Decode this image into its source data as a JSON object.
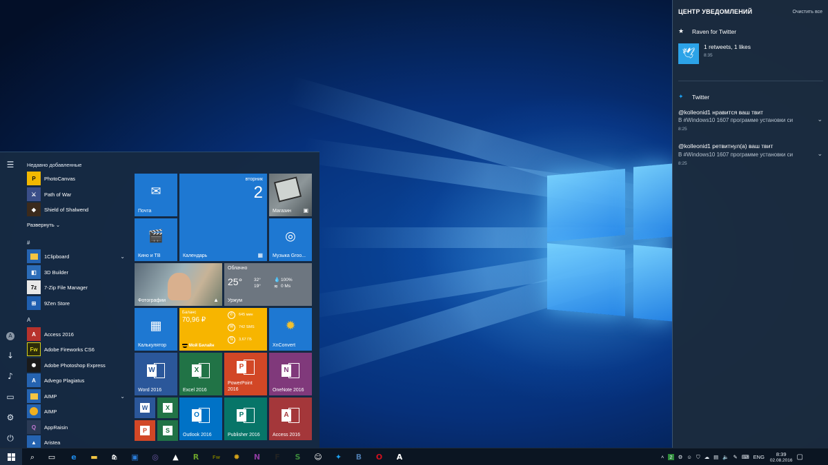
{
  "start_menu": {
    "recently_added_header": "Недавно добавленные",
    "recent": [
      {
        "label": "PhotoCanvas",
        "icon": "photocanvas-icon",
        "color": "#f2b800"
      },
      {
        "label": "Path of War",
        "icon": "path-of-war-icon",
        "color": "#3a4e88"
      },
      {
        "label": "Shield of Shalwend",
        "icon": "shield-icon",
        "color": "#3b2a1c"
      }
    ],
    "expand_label": "Развернуть",
    "sections": [
      {
        "letter": "#",
        "apps": [
          {
            "label": "1Clipboard",
            "icon": "folder-icon",
            "color": "#f5c542",
            "chevron": true
          },
          {
            "label": "3D Builder",
            "icon": "3d-builder-icon",
            "color": "#2b6cb8"
          },
          {
            "label": "7-Zip File Manager",
            "icon": "7zip-icon",
            "color": "#e8e8e8"
          },
          {
            "label": "9Zen Store",
            "icon": "store-icon",
            "color": "#1f5fb0"
          }
        ]
      },
      {
        "letter": "A",
        "apps": [
          {
            "label": "Access 2016",
            "icon": "access-icon",
            "color": "#b7322c"
          },
          {
            "label": "Adobe Fireworks CS6",
            "icon": "fireworks-icon",
            "color": "#2b2b0a"
          },
          {
            "label": "Adobe Photoshop Express",
            "icon": "photoshop-express-icon",
            "color": "#1a1a1a"
          },
          {
            "label": "Advego Plagiatus",
            "icon": "advego-icon",
            "color": "#2563b0"
          },
          {
            "label": "AIMP",
            "icon": "folder-icon",
            "color": "#f5c542",
            "chevron": true
          },
          {
            "label": "AIMP",
            "icon": "aimp-icon",
            "color": "#2563b0"
          },
          {
            "label": "AppRaisin",
            "icon": "appraisin-icon",
            "color": "#2a3a55"
          },
          {
            "label": "Aristea",
            "icon": "aristea-icon",
            "color": "#2563b0"
          }
        ]
      }
    ],
    "tiles": {
      "mail": "Почта",
      "calendar": {
        "label": "Календарь",
        "day": "вторник",
        "date": "2"
      },
      "store": "Магазин",
      "movies": "Кино и ТВ",
      "music": "Музыка Groo...",
      "photos": "Фотографии",
      "weather": {
        "cond": "Облачно",
        "temp": "25°",
        "hi": "32°",
        "lo": "19°",
        "humidity": "100%",
        "wind": "0 Ms",
        "city": "Уржум"
      },
      "calculator": "Калькулятор",
      "wallet": {
        "title": "Баланс",
        "amount": "70,96 ₽",
        "calls": "645 мин",
        "sms": "742 SMS",
        "data": "3,67 ГБ",
        "brand": "Мой Билайн"
      },
      "xnconvert": "XnConvert",
      "word": "Word 2016",
      "excel": "Excel 2016",
      "powerpoint": "PowerPoint 2016",
      "onenote": "OneNote 2016",
      "outlook": "Outlook 2016",
      "publisher": "Publisher 2016",
      "access": "Access 2016",
      "mini": [
        "W",
        "X",
        "P",
        "S"
      ]
    }
  },
  "action_center": {
    "title": "ЦЕНТР УВЕДОМЛЕНИЙ",
    "clear_all": "Очистить все",
    "groups": [
      {
        "app": "Raven for Twitter",
        "items": [
          {
            "text": "1 retweets, 1 likes",
            "time": "8:35"
          }
        ]
      },
      {
        "app": "Twitter",
        "items": [
          {
            "text": "@kolleonid1 нравится ваш твит",
            "sub": "В #Windows10 1607 программе установки си",
            "time": "8:25"
          },
          {
            "text": "@kolleonid1 ретвитнул(а) ваш твит",
            "sub": "В #Windows10 1607 программе установки си",
            "time": "8:25"
          }
        ]
      }
    ]
  },
  "taskbar": {
    "lang": "ENG",
    "time": "8:39",
    "date": "02.08.2016",
    "badge": "2",
    "apps": [
      {
        "name": "edge-icon",
        "glyph": "e",
        "color": "#1e88e5"
      },
      {
        "name": "file-explorer-icon",
        "glyph": "▬",
        "color": "#f2c443"
      },
      {
        "name": "store-icon",
        "glyph": "🛍",
        "color": "#ffffff"
      },
      {
        "name": "photos-app-icon",
        "glyph": "▣",
        "color": "#2a7bd6"
      },
      {
        "name": "chat-icon",
        "glyph": "◎",
        "color": "#6f5aa8"
      },
      {
        "name": "bag-icon",
        "glyph": "▲",
        "color": "#ffffff"
      },
      {
        "name": "rss-icon",
        "glyph": "R",
        "color": "#6aa02a"
      },
      {
        "name": "fireworks-icon",
        "glyph": "Fw",
        "color": "#6b6b00"
      },
      {
        "name": "xnconvert-icon",
        "glyph": "✹",
        "color": "#d4a21a"
      },
      {
        "name": "onenote-icon",
        "glyph": "N",
        "color": "#8c3b9e"
      },
      {
        "name": "forza-icon",
        "glyph": "F",
        "color": "#222222"
      },
      {
        "name": "s-app-icon",
        "glyph": "S",
        "color": "#3c8a3c"
      },
      {
        "name": "people-icon",
        "glyph": "☺",
        "color": "#ffffff"
      },
      {
        "name": "twitter-icon",
        "glyph": "✦",
        "color": "#1da1f2"
      },
      {
        "name": "vk-icon",
        "glyph": "B",
        "color": "#4a76a8"
      },
      {
        "name": "opera-icon",
        "glyph": "O",
        "color": "#d0101f"
      },
      {
        "name": "font-app-icon",
        "glyph": "A",
        "color": "#ffffff"
      }
    ]
  }
}
